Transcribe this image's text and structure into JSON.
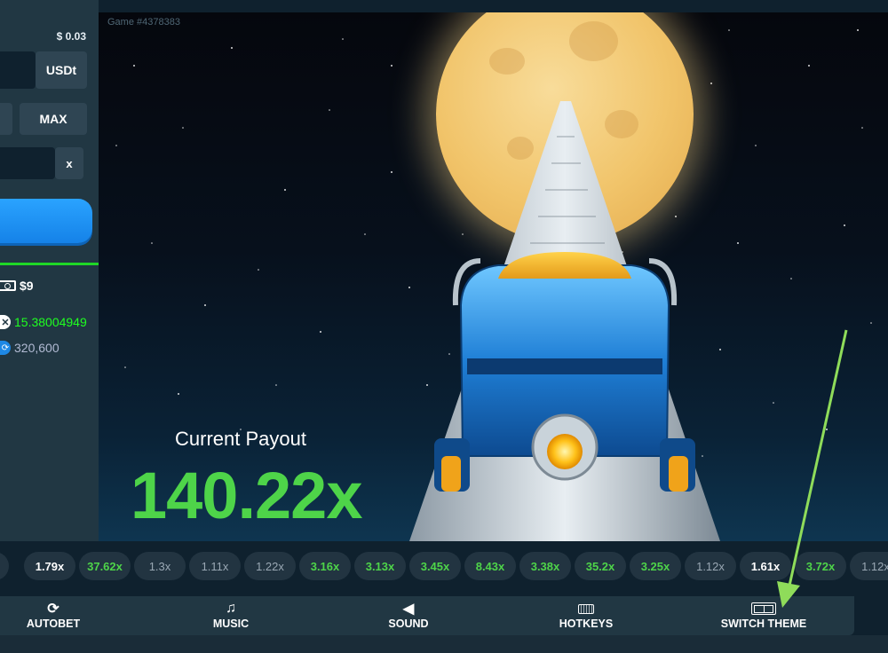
{
  "sidebar": {
    "bet_amount_usd": "$ 0.03",
    "currency": "USDt",
    "max_label": "MAX",
    "target_suffix": "x",
    "total_profit": "$9",
    "stat_multiplier": "15.38004949",
    "stat_count": "320,600"
  },
  "game": {
    "id_label": "Game #4378383",
    "payout_label": "Current Payout",
    "payout_value": "140.22x"
  },
  "history": [
    "x",
    "1.79x",
    "37.62x",
    "1.3x",
    "1.11x",
    "1.22x",
    "3.16x",
    "3.13x",
    "3.45x",
    "8.43x",
    "3.38x",
    "35.2x",
    "3.25x",
    "1.12x",
    "1.61x",
    "3.72x",
    "1.12x"
  ],
  "history_styles": [
    "gray",
    "white",
    "green",
    "gray",
    "gray",
    "gray",
    "green",
    "green",
    "green",
    "green",
    "green",
    "green",
    "green",
    "gray",
    "white",
    "green",
    "gray"
  ],
  "bottombar": {
    "autobet": "AUTOBET",
    "music": "MUSIC",
    "sound": "SOUND",
    "hotkeys": "HOTKEYS",
    "switch_theme": "SWITCH THEME"
  },
  "colors": {
    "sidebar_bg": "#213743",
    "page_bg": "#0f212e",
    "accent_green": "#4ed449",
    "bet_blue": "#1582e8",
    "annotation_arrow": "#8fdc5a"
  },
  "icons": [
    "cash-icon",
    "multiplier-x-icon",
    "coin-icon",
    "autobet-refresh-icon",
    "music-note-icon",
    "speaker-icon",
    "keyboard-icon",
    "switch-theme-icon"
  ]
}
